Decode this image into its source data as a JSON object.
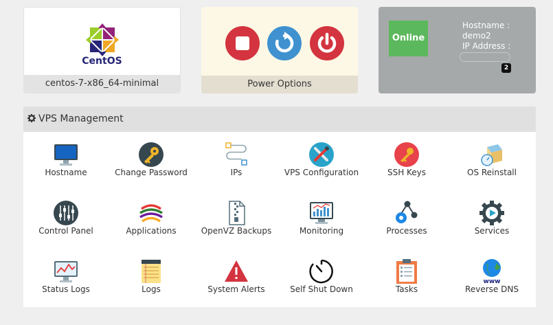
{
  "os_card": {
    "logo_text": "CentOS",
    "template_name": "centos-7-x86_64-minimal"
  },
  "power_card": {
    "label": "Power Options"
  },
  "status_card": {
    "status": "Online",
    "hostname_label": "Hostname :",
    "hostname": "demo2",
    "ip_label": "IP Address :",
    "ip_count": "2"
  },
  "management": {
    "title": "VPS Management",
    "tiles": [
      {
        "label": "Hostname",
        "icon": "monitor-icon"
      },
      {
        "label": "Change Password",
        "icon": "key-circle-icon"
      },
      {
        "label": "IPs",
        "icon": "network-icon"
      },
      {
        "label": "VPS Configuration",
        "icon": "tools-icon"
      },
      {
        "label": "SSH Keys",
        "icon": "ssh-key-icon"
      },
      {
        "label": "OS Reinstall",
        "icon": "reinstall-icon"
      },
      {
        "label": "Control Panel",
        "icon": "sliders-icon"
      },
      {
        "label": "Applications",
        "icon": "apps-icon"
      },
      {
        "label": "OpenVZ Backups",
        "icon": "zip-file-icon"
      },
      {
        "label": "Monitoring",
        "icon": "chart-monitor-icon"
      },
      {
        "label": "Processes",
        "icon": "share-gear-icon"
      },
      {
        "label": "Services",
        "icon": "service-gear-icon"
      },
      {
        "label": "Status Logs",
        "icon": "line-chart-icon"
      },
      {
        "label": "Logs",
        "icon": "notepad-icon"
      },
      {
        "label": "System Alerts",
        "icon": "warning-icon"
      },
      {
        "label": "Self Shut Down",
        "icon": "timer-icon"
      },
      {
        "label": "Tasks",
        "icon": "clipboard-icon"
      },
      {
        "label": "Reverse DNS",
        "icon": "globe-www-icon"
      }
    ]
  },
  "colors": {
    "online": "#5cb85c",
    "power_red": "#d3343f",
    "restart_blue": "#3f92cf"
  }
}
